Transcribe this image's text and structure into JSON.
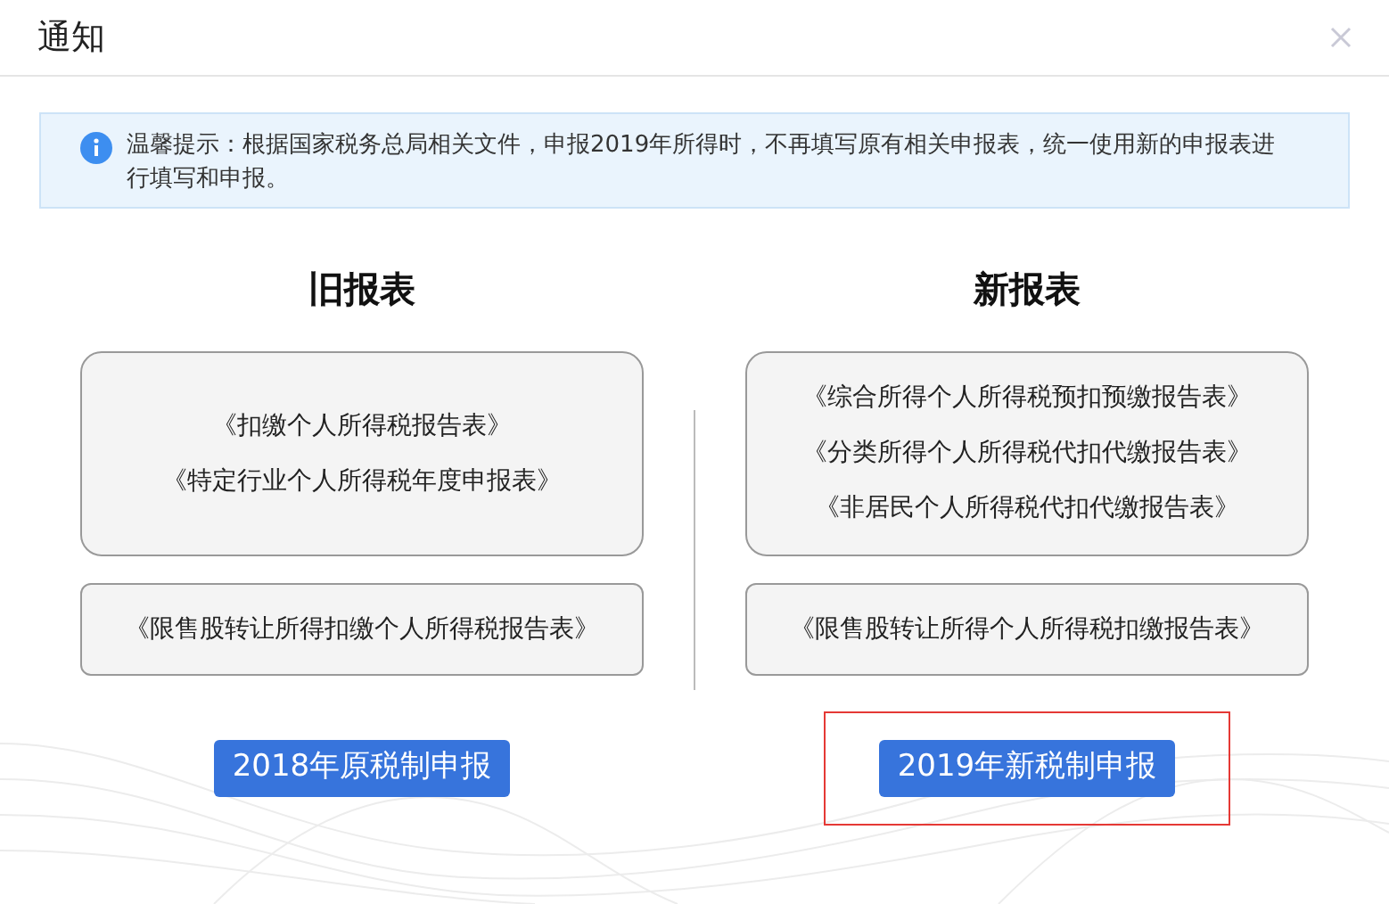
{
  "dialog": {
    "title": "通知"
  },
  "notice": {
    "text": "温馨提示：根据国家税务总局相关文件，申报2019年所得时，不再填写原有相关申报表，统一使用新的申报表进行填写和申报。"
  },
  "columns": [
    {
      "title": "旧报表",
      "groups": [
        {
          "items": [
            "《扣缴个人所得税报告表》",
            "《特定行业个人所得税年度申报表》"
          ]
        },
        {
          "items": [
            "《限售股转让所得扣缴个人所得税报告表》"
          ]
        }
      ],
      "button": {
        "label": "2018年原税制申报",
        "highlighted": false
      }
    },
    {
      "title": "新报表",
      "groups": [
        {
          "items": [
            "《综合所得个人所得税预扣预缴报告表》",
            "《分类所得个人所得税代扣代缴报告表》",
            "《非居民个人所得税代扣代缴报告表》"
          ]
        },
        {
          "items": [
            "《限售股转让所得个人所得税扣缴报告表》"
          ]
        }
      ],
      "button": {
        "label": "2019年新税制申报",
        "highlighted": true
      }
    }
  ]
}
